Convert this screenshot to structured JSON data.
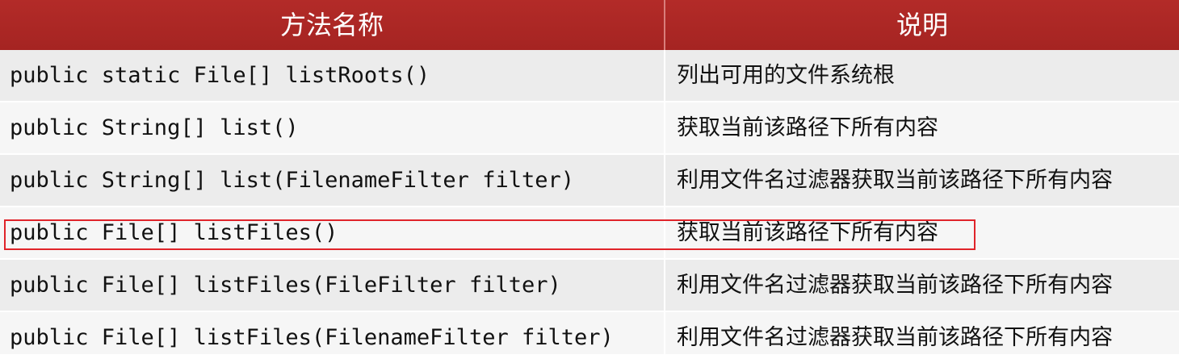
{
  "table": {
    "header": {
      "method": "方法名称",
      "description": "说明"
    },
    "rows": [
      {
        "method": "public static File[] listRoots()",
        "description": "列出可用的文件系统根"
      },
      {
        "method": "public String[] list()",
        "description": "获取当前该路径下所有内容"
      },
      {
        "method": "public String[] list(FilenameFilter filter)",
        "description": "利用文件名过滤器获取当前该路径下所有内容"
      },
      {
        "method": "public File[] listFiles()",
        "description": "获取当前该路径下所有内容"
      },
      {
        "method": "public File[] listFiles(FileFilter filter)",
        "description": "利用文件名过滤器获取当前该路径下所有内容"
      },
      {
        "method": "public File[] listFiles(FilenameFilter filter)",
        "description": "利用文件名过滤器获取当前该路径下所有内容"
      }
    ],
    "highlighted_row": 3
  },
  "colors": {
    "header_bg": "#a52422",
    "header_text": "#ffffff",
    "row_bg_light": "#f6f6f6",
    "row_bg_dark": "#ececec",
    "highlight_border": "#e0242a"
  }
}
